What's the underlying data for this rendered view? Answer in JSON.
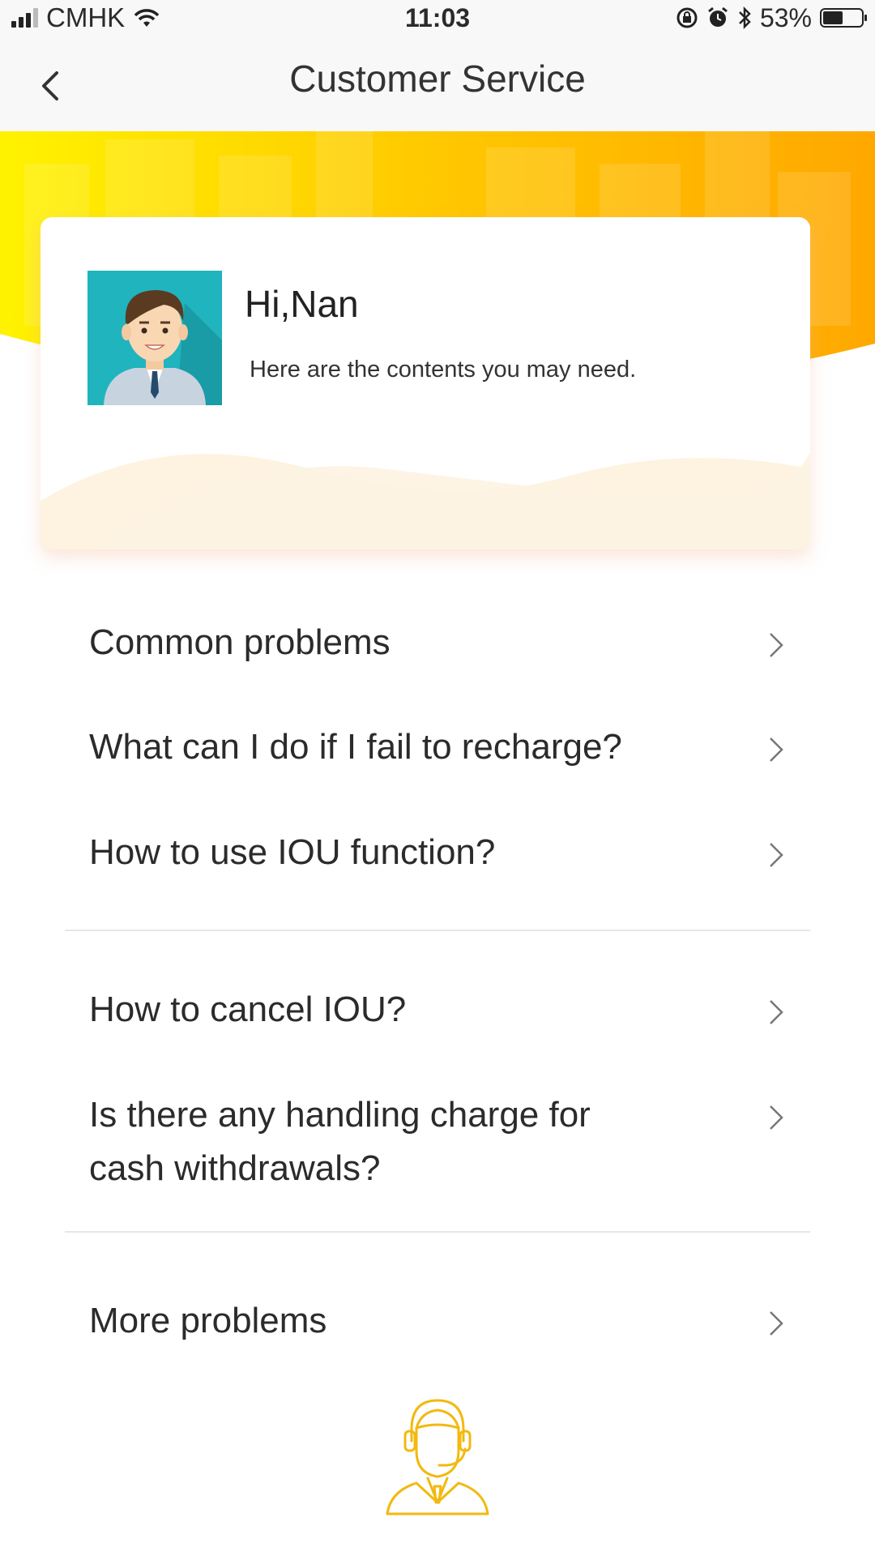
{
  "status_bar": {
    "carrier": "CMHK",
    "time": "11:03",
    "battery": "53%",
    "battery_level": 0.53
  },
  "nav": {
    "title": "Customer Service",
    "back_icon": "chevron-left-icon"
  },
  "card": {
    "greeting": "Hi,Nan",
    "subtitle": "Here are the contents you may need.",
    "avatar_icon": "user-avatar"
  },
  "list": {
    "items": [
      {
        "label": "Common problems"
      },
      {
        "label": "What can I do if I fail to recharge?"
      },
      {
        "label": "How to use IOU function?"
      },
      {
        "label": "How to cancel IOU?"
      },
      {
        "label": "Is there any handling charge for cash withdrawals?"
      },
      {
        "label": "More problems"
      }
    ]
  },
  "colors": {
    "banner_yellow": "#FFE000",
    "banner_orange": "#FFAA00",
    "accent": "#F2B90F"
  }
}
